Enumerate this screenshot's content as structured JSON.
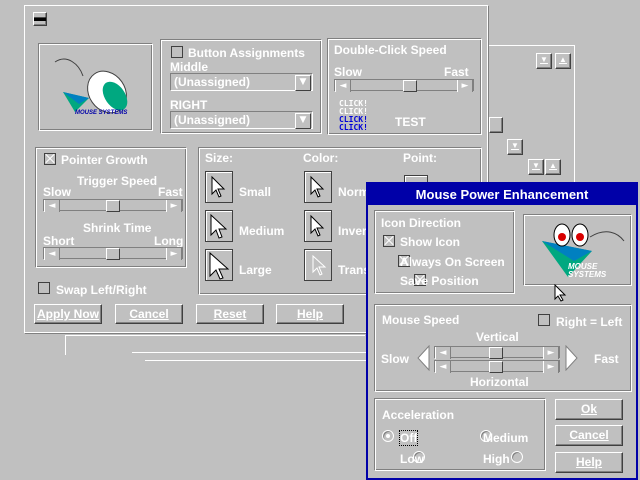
{
  "main": {
    "button_assignments_label": "Button Assignments",
    "middle_label": "Middle",
    "middle_value": "(Unassigned)",
    "right_label": "RIGHT",
    "right_value": "(Unassigned)",
    "double_click_label": "Double-Click Speed",
    "slow_label": "Slow",
    "fast_label": "Fast",
    "click_words": [
      "CLICK!",
      "CLICK!",
      "CLICK!",
      "CLICK!"
    ],
    "test_label": "TEST",
    "pointer_growth_label": "Pointer Growth",
    "trigger_speed_label": "Trigger Speed",
    "slow2": "Slow",
    "fast2": "Fast",
    "shrink_time_label": "Shrink Time",
    "short_label": "Short",
    "long_label": "Long",
    "size_label": "Size:",
    "color_label": "Color:",
    "point_label": "Point:",
    "sizes": [
      "Small",
      "Medium",
      "Large"
    ],
    "colors": [
      "Norm",
      "Inver",
      "Trans"
    ],
    "swap_label": "Swap Left/Right",
    "apply_label": "Apply Now",
    "cancel_label": "Cancel",
    "reset_label": "Reset",
    "help_label": "Help",
    "logo_text": "MOUSE SYSTEMS"
  },
  "dialog": {
    "title": "Mouse Power Enhancement",
    "icon_direction_label": "Icon Direction",
    "show_icon_label": "Show Icon",
    "always_on_screen_label": "Always On Screen",
    "save_position_label": "Save Position",
    "logo_text": "MOUSE SYSTEMS",
    "mouse_speed_label": "Mouse Speed",
    "right_equals_left_label": "Right = Left",
    "vertical_label": "Vertical",
    "horizontal_label": "Horizontal",
    "slow_label": "Slow",
    "fast_label": "Fast",
    "acceleration_label": "Acceleration",
    "off_label": "Off",
    "low_label": "Low",
    "medium_label": "Medium",
    "high_label": "High",
    "ok_label": "Ok",
    "cancel_label": "Cancel",
    "help_label": "Help",
    "title_color": "#0000a8",
    "accent_green": "#00a880"
  },
  "icons": [
    "system-menu-icon",
    "mouse-logo-icon",
    "arrow-cursor-icon",
    "scroll-left-icon",
    "scroll-right-icon",
    "dropdown-arrow-icon",
    "eyes-logo-icon"
  ]
}
